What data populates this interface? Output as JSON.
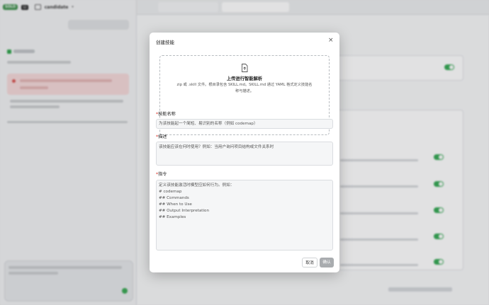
{
  "background": {
    "solo_badge": "SOLO",
    "sd_badge": "SD",
    "project": "candidate"
  },
  "dialog": {
    "title": "创建技能",
    "upload": {
      "title": "上传进行智能解析",
      "description": "zip 或 .skill 文件。根目录包含 SKILL.md。SKILL.md 通过 YAML 格式定义技能名称与描述。"
    },
    "name_field": {
      "label": "技能名称",
      "placeholder": "为该技能起一个简短、易识别的名称（例如 codemap）"
    },
    "description_field": {
      "label": "描述",
      "placeholder": "该技能应该在何时使用？例如：当用户询问项目结构或文件关系时"
    },
    "instructions_field": {
      "label": "指令",
      "placeholder": "定义该技能激活时模型应如何行为。例如：\n# codemap\n## Commands\n## When to Use\n## Output Interpretation\n## Examples"
    },
    "required_mark": "*",
    "cancel_label": "取消",
    "confirm_label": "确认"
  },
  "colors": {
    "accent_green": "#34a853",
    "required_red": "#d93025",
    "confirm_disabled": "#a9acaf"
  }
}
